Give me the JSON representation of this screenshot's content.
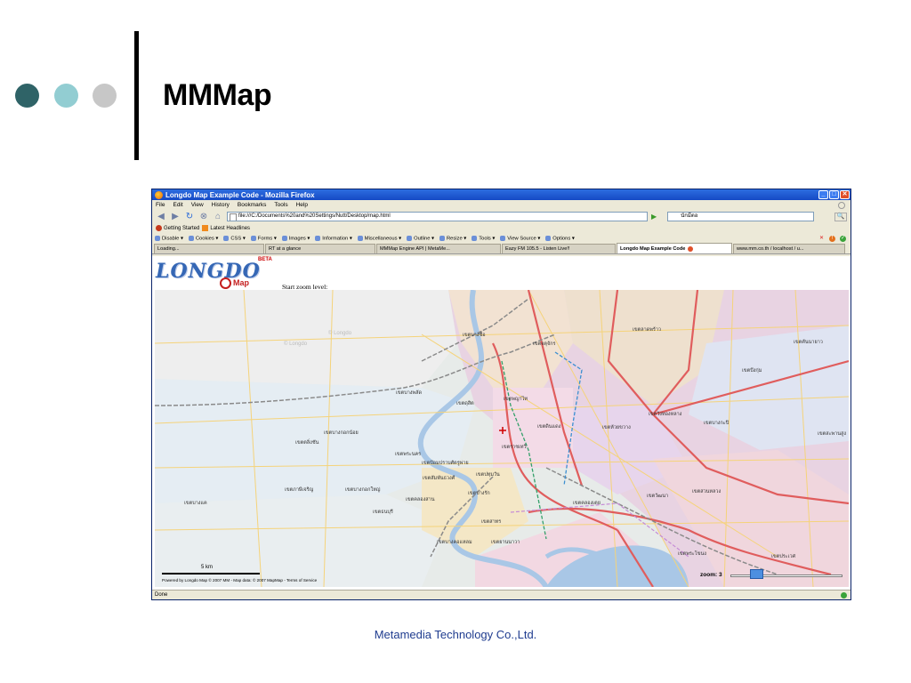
{
  "slide": {
    "title": "MMMap",
    "footer": "Metamedia Technology Co.,Ltd.",
    "colors": {
      "dot1": "#2f6367",
      "dot2": "#92cdd2",
      "dot3": "#c7c7c7",
      "footer_text": "#1f3c8f"
    }
  },
  "browser": {
    "window_title": "Longdo Map Example Code - Mozilla Firefox",
    "window_buttons": {
      "minimize": "_",
      "maximize": "□",
      "close": "✕"
    },
    "menu": [
      "File",
      "Edit",
      "View",
      "History",
      "Bookmarks",
      "Tools",
      "Help"
    ],
    "nav": {
      "back": "◀",
      "forward": "▶",
      "reload": "↻",
      "stop": "⊗",
      "home": "⌂",
      "go": "▶"
    },
    "url": "file:///C:/Documents%20and%20Settings/Nutt/Desktop/map.html",
    "search_value": "นักมีตอ",
    "search_button": "🔍",
    "bookmarks": [
      "Getting Started",
      "Latest Headlines"
    ],
    "dev_toolbar": [
      "Disable ▾",
      "Cookies ▾",
      "CSS ▾",
      "Forms ▾",
      "Images ▾",
      "Information ▾",
      "Miscellaneous ▾",
      "Outline ▾",
      "Resize ▾",
      "Tools ▾",
      "View Source ▾",
      "Options ▾"
    ],
    "dev_status_icons": [
      "✕",
      "!",
      "✓"
    ],
    "tabs": [
      {
        "label": "Loading...",
        "active": false
      },
      {
        "label": "RT at a glance",
        "active": false
      },
      {
        "label": "MMMap Engine API | MetaMe...",
        "active": false
      },
      {
        "label": "Eazy FM 105.5 - Listen Live!!",
        "active": false
      },
      {
        "label": "Longdo Map Example Code",
        "active": true
      },
      {
        "label": "www.mm.co.th / localhost / u...",
        "active": false
      }
    ],
    "status_text": "Done"
  },
  "page": {
    "logo_text": "LONGDO",
    "logo_badge": "BETA",
    "logo_sub": "Map",
    "start_zoom_label": "Start zoom level:",
    "map": {
      "scale": "5 km",
      "powered_by": "Powered by Longdo Map © 2007 MM - Map data: © 2007 MapMap - Terms of Service",
      "zoom_label": "zoom: 3",
      "zoom_fraction": 0.2,
      "watermarks": [
        "© Longdo",
        "© Longdo"
      ],
      "districts": [
        "เขตบางซื่อ",
        "เขตจตุจักร",
        "เขตลาดพร้าว",
        "เขตคันนายาว",
        "เขตบึงกุ่ม",
        "เขตบางพลัด",
        "เขตดุสิต",
        "เขตพญาไท",
        "เขตดินแดง",
        "เขตห้วยขวาง",
        "เขตวังทองหลาง",
        "เขตบางกะปิ",
        "เขตสะพานสูง",
        "เขตบางกอกน้อย",
        "เขตตลิ่งชัน",
        "เขตพระนคร",
        "เขตป้อมปราบศัตรูพ่าย",
        "เขตราชเทวี",
        "เขตสัมพันธวงศ์",
        "เขตปทุมวัน",
        "เขตภาษีเจริญ",
        "เขตบางกอกใหญ่",
        "เขตคลองสาน",
        "เขตบางรัก",
        "เขตคลองเตย",
        "เขตวัฒนา",
        "เขตสวนหลวง",
        "เขตบางแค",
        "เขตธนบุรี",
        "เขตสาทร",
        "เขตบางคอแหลม",
        "เขตยานนาวา",
        "เขตพระโขนง",
        "เขตประเวศ"
      ]
    }
  }
}
